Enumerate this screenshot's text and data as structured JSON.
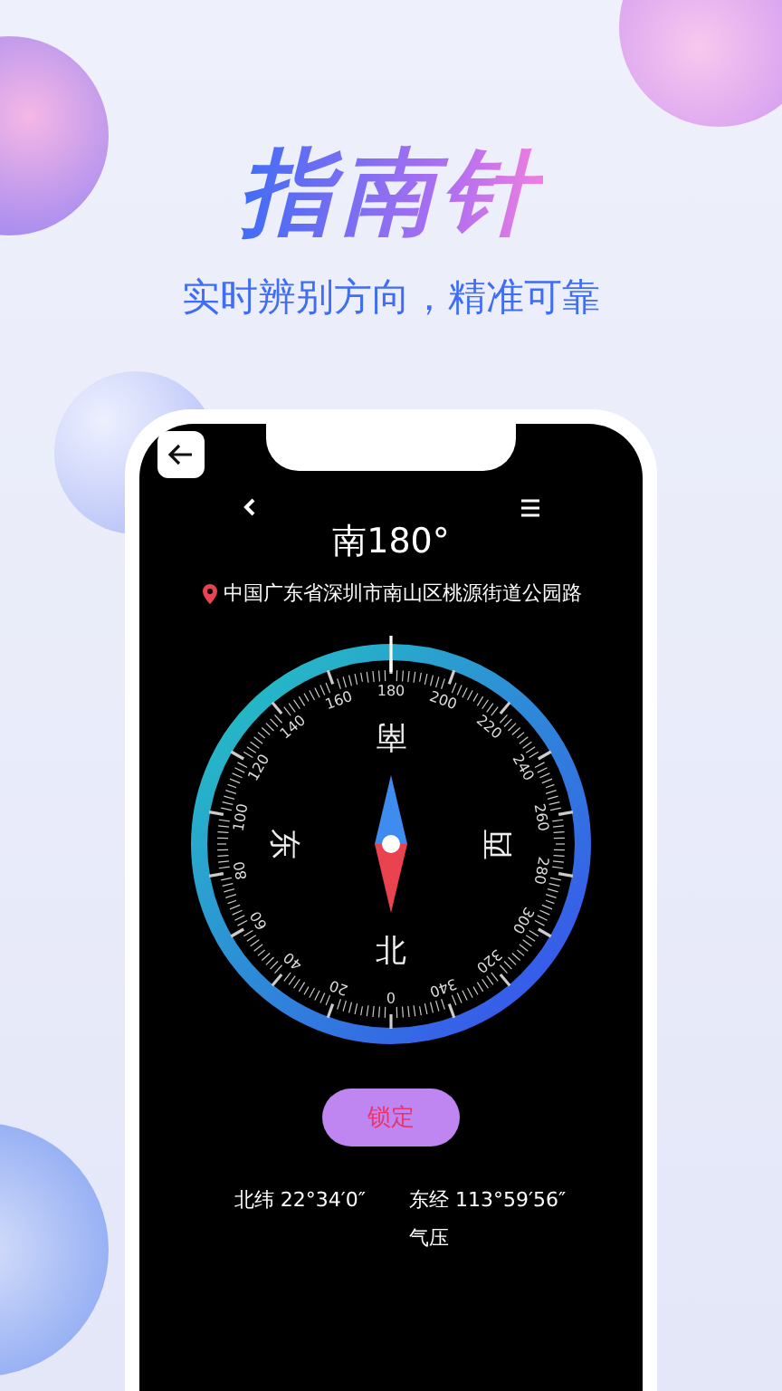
{
  "headline": "指南针",
  "tagline": "实时辨别方向，精准可靠",
  "phone": {
    "heading": "南180°",
    "location": "中国广东省深圳市南山区桃源街道公园路",
    "dial_labels": [
      "0",
      "20",
      "40",
      "60",
      "80",
      "100",
      "120",
      "140",
      "160",
      "180",
      "200",
      "220",
      "240",
      "260",
      "280",
      "300",
      "320",
      "340"
    ],
    "cardinals": [
      "北",
      "东",
      "南",
      "西"
    ],
    "lock_button": "锁定",
    "latitude": "北纬 22°34′0″",
    "longitude": "东经 113°59′56″",
    "pressure": "气压"
  }
}
